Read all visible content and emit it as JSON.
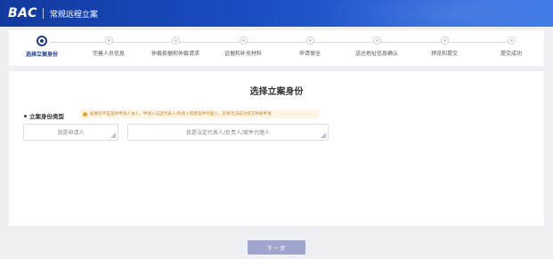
{
  "header": {
    "logo": "BAC",
    "title": "常规远程立案"
  },
  "steps": [
    {
      "label": "选择立案身份",
      "active": true
    },
    {
      "label": "完善人员信息",
      "active": false
    },
    {
      "label": "仲裁依据和仲裁请求",
      "active": false
    },
    {
      "label": "证据和补充材料",
      "active": false
    },
    {
      "label": "申请保全",
      "active": false
    },
    {
      "label": "送达地址信息确认",
      "active": false
    },
    {
      "label": "预览和提交",
      "active": false
    },
    {
      "label": "提交成功",
      "active": false
    }
  ],
  "main": {
    "section_title": "选择立案身份",
    "field_label": "立案身份类型",
    "notice": "如果您不是案件申请人本人、申请人法定代表人/负责人或者案件代理人，您将无法成功提交仲裁申请",
    "options": [
      {
        "label": "我是申请人"
      },
      {
        "label": "我是法定代表人/负责人/案件代理人"
      }
    ]
  },
  "footer": {
    "next_label": "下一步"
  },
  "colors": {
    "header": "#1a4cc2",
    "accent": "#1e3a8a",
    "button": "#9fa5cc",
    "warning": "#f0a020"
  }
}
